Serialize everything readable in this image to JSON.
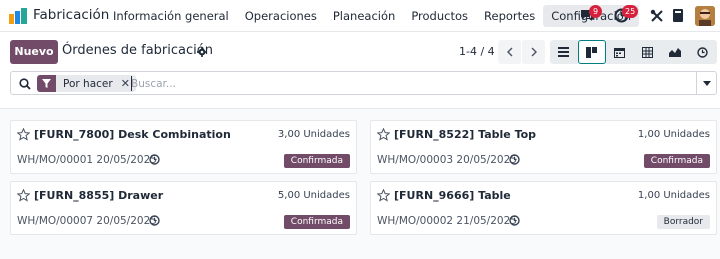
{
  "app": {
    "title": "Fabricación"
  },
  "navbar": {
    "menu": [
      "Información general",
      "Operaciones",
      "Planeación",
      "Productos",
      "Reportes",
      "Configuración"
    ],
    "active_menu": "Configuración",
    "messages_count": "9",
    "activities_count": "25"
  },
  "control_panel": {
    "new_button": "Nuevo",
    "breadcrumb": "Órdenes de fabricación",
    "pager": "1-4 / 4",
    "active_view": "kanban"
  },
  "search": {
    "facet": "Por hacer",
    "placeholder": "Buscar..."
  },
  "cards": [
    {
      "title": "[FURN_7800] Desk Combination",
      "quantity": "3,00 Unidades",
      "reference": "WH/MO/00001 20/05/2025",
      "status": "Confirmada",
      "status_kind": "confirmed"
    },
    {
      "title": "[FURN_8522] Table Top",
      "quantity": "1,00 Unidades",
      "reference": "WH/MO/00003 20/05/2025",
      "status": "Confirmada",
      "status_kind": "confirmed"
    },
    {
      "title": "[FURN_8855] Drawer",
      "quantity": "5,00 Unidades",
      "reference": "WH/MO/00007 20/05/2025",
      "status": "Confirmada",
      "status_kind": "confirmed"
    },
    {
      "title": "[FURN_9666] Table",
      "quantity": "1,00 Unidades",
      "reference": "WH/MO/00002 21/05/2025",
      "status": "Borrador",
      "status_kind": "draft"
    }
  ],
  "colors": {
    "brand": "#714b67",
    "active_view_border": "#017e84",
    "badge": "#d6213c"
  }
}
